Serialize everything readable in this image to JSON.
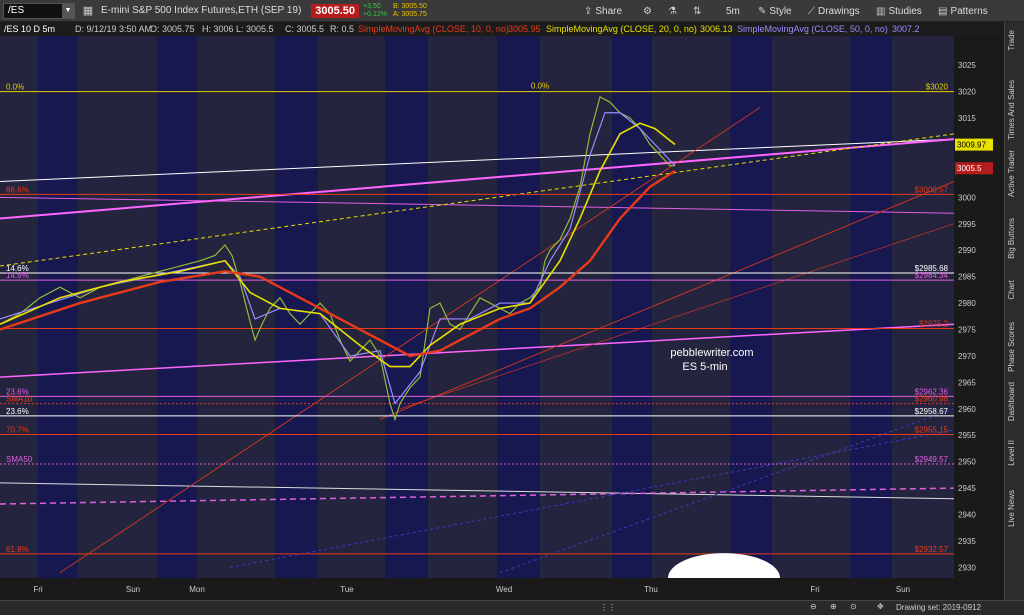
{
  "toolbar": {
    "symbol": "/ES",
    "description": "E-mini S&P 500 Index Futures,ETH (SEP 19)",
    "last": "3005.50",
    "change": "+3.50",
    "change_pct": "+0.12%",
    "bid": "B: 3005.50",
    "ask": "A: 3005.75",
    "share": "Share",
    "timeframe": "5m",
    "style": "Style",
    "drawings": "Drawings",
    "studies": "Studies",
    "patterns": "Patterns"
  },
  "status": {
    "symbol_tf": "/ES 10 D 5m",
    "date": "D: 9/12/19 3:50 AM",
    "open": "O: 3005.75",
    "high": "H: 3006",
    "low": "L: 3005.5",
    "close": "C: 3005.5",
    "range": "R: 0.5",
    "sma10_label": "SimpleMovingAvg (CLOSE, 10, 0, no)",
    "sma10_val": "3005.95",
    "sma20_label": "SimpleMovingAvg (CLOSE, 20, 0, no)",
    "sma20_val": "3006.13",
    "sma50_label": "SimpleMovingAvg (CLOSE, 50, 0, no)",
    "sma50_val": "3007.2"
  },
  "right_tabs": [
    "Trade",
    "Times And Sales",
    "Active Trader",
    "Big Buttons",
    "Chart",
    "Phase Scores",
    "Dashboard",
    "Level II",
    "Live News"
  ],
  "x_labels": [
    "Fri",
    "Sun",
    "Mon",
    "Tue",
    "Wed",
    "Thu",
    "Fri",
    "Sun"
  ],
  "bottom": {
    "drawing_set": "Drawing set: 2019-0912"
  },
  "annotation": {
    "line1": "pebblewriter.com",
    "line2": "ES 5-min"
  },
  "colors": {
    "bg": "#14142a",
    "session": "#1c1c4e",
    "sma10": "#9a8cff",
    "sma20": "#e8e000",
    "sma50": "#e83a1a",
    "price_badge": "#b71c1c"
  },
  "chart_data": {
    "type": "line",
    "y_axis_ticks": [
      2930,
      2935,
      2940,
      2945,
      2950,
      2955,
      2960,
      2965,
      2970,
      2975,
      2980,
      2985,
      2990,
      2995,
      3000,
      3005,
      3010,
      3015,
      3020,
      3025
    ],
    "ylim": [
      2928,
      3029
    ],
    "current_price": 3005.5,
    "levels": [
      {
        "label_left": "0.0%",
        "label_mid": "0.0%",
        "label_right": "$3020",
        "value": 3020,
        "color": "#e8d000",
        "style": "solid"
      },
      {
        "label_left": "88.6%",
        "label_right": "$3000.57",
        "value": 3000.57,
        "color": "#e83a1a",
        "style": "solid"
      },
      {
        "label_left": "14.6%",
        "label_right": "$2985.68",
        "value": 2985.68,
        "color": "#ffffff",
        "style": "solid"
      },
      {
        "label_left": "14.6%",
        "label_right": "$2984.34",
        "value": 2984.34,
        "color": "#e060e0",
        "style": "solid"
      },
      {
        "label_left": "",
        "label_right": "$2975.2",
        "value": 2975.2,
        "color": "#e83a1a",
        "style": "solid"
      },
      {
        "label_left": "23.6%",
        "label_right": "$2962.36",
        "value": 2962.36,
        "color": "#e060e0",
        "style": "solid"
      },
      {
        "label_left": "SMA10",
        "label_right": "$2960.98",
        "value": 2960.98,
        "color": "#e83a1a",
        "style": "dotted"
      },
      {
        "label_left": "23.6%",
        "label_right": "$2958.67",
        "value": 2958.67,
        "color": "#ffffff",
        "style": "solid"
      },
      {
        "label_left": "70.7%",
        "label_right": "$2955.15",
        "value": 2955.15,
        "color": "#e83a1a",
        "style": "solid"
      },
      {
        "label_left": "SMA50",
        "label_right": "$2949.57",
        "value": 2949.57,
        "color": "#e060e0",
        "style": "dotted"
      },
      {
        "label_left": "61.8%",
        "label_right": "$2932.57",
        "value": 2932.57,
        "color": "#e83a1a",
        "style": "solid"
      }
    ],
    "price_tags": [
      {
        "label": "3009.97",
        "value": 3009.97,
        "color": "#e8e000",
        "text": "#000"
      },
      {
        "label": "3005.5",
        "value": 3005.5,
        "color": "#b71c1c",
        "text": "#fff"
      }
    ],
    "price_path": [
      [
        0,
        2976
      ],
      [
        20,
        2978
      ],
      [
        40,
        2981
      ],
      [
        60,
        2983
      ],
      [
        80,
        2981
      ],
      [
        100,
        2983
      ],
      [
        120,
        2984
      ],
      [
        140,
        2985
      ],
      [
        160,
        2986
      ],
      [
        180,
        2987
      ],
      [
        200,
        2988
      ],
      [
        215,
        2989
      ],
      [
        225,
        2991
      ],
      [
        232,
        2989
      ],
      [
        240,
        2984
      ],
      [
        248,
        2978
      ],
      [
        255,
        2973
      ],
      [
        262,
        2976
      ],
      [
        270,
        2979
      ],
      [
        280,
        2981
      ],
      [
        290,
        2978
      ],
      [
        300,
        2976
      ],
      [
        310,
        2978
      ],
      [
        320,
        2980
      ],
      [
        330,
        2978
      ],
      [
        340,
        2973
      ],
      [
        350,
        2969
      ],
      [
        360,
        2971
      ],
      [
        370,
        2973
      ],
      [
        380,
        2970
      ],
      [
        390,
        2961
      ],
      [
        395,
        2958
      ],
      [
        400,
        2961
      ],
      [
        410,
        2964
      ],
      [
        420,
        2966
      ],
      [
        430,
        2979
      ],
      [
        440,
        2980
      ],
      [
        450,
        2976
      ],
      [
        460,
        2975
      ],
      [
        470,
        2978
      ],
      [
        480,
        2981
      ],
      [
        490,
        2980
      ],
      [
        500,
        2979
      ],
      [
        510,
        2978
      ],
      [
        520,
        2980
      ],
      [
        530,
        2981
      ],
      [
        540,
        2983
      ],
      [
        545,
        2988
      ],
      [
        550,
        2990
      ],
      [
        560,
        2992
      ],
      [
        570,
        2996
      ],
      [
        580,
        3002
      ],
      [
        590,
        3012
      ],
      [
        600,
        3019
      ],
      [
        610,
        3018
      ],
      [
        620,
        3016
      ],
      [
        630,
        3015
      ],
      [
        640,
        3013
      ],
      [
        650,
        3010
      ],
      [
        660,
        3008
      ],
      [
        670,
        3006
      ],
      [
        675,
        3006
      ]
    ],
    "sma10_path": [
      [
        0,
        2977
      ],
      [
        50,
        2980
      ],
      [
        100,
        2983
      ],
      [
        150,
        2985
      ],
      [
        200,
        2987
      ],
      [
        225,
        2988
      ],
      [
        240,
        2985
      ],
      [
        255,
        2977
      ],
      [
        280,
        2979
      ],
      [
        320,
        2978
      ],
      [
        350,
        2970
      ],
      [
        380,
        2971
      ],
      [
        395,
        2961
      ],
      [
        420,
        2967
      ],
      [
        440,
        2977
      ],
      [
        470,
        2977
      ],
      [
        500,
        2980
      ],
      [
        530,
        2980
      ],
      [
        550,
        2988
      ],
      [
        570,
        2994
      ],
      [
        590,
        3008
      ],
      [
        605,
        3016
      ],
      [
        620,
        3016
      ],
      [
        640,
        3013
      ],
      [
        660,
        3009
      ],
      [
        675,
        3006
      ]
    ],
    "sma20_path": [
      [
        0,
        2976
      ],
      [
        60,
        2981
      ],
      [
        120,
        2984
      ],
      [
        180,
        2986
      ],
      [
        225,
        2988
      ],
      [
        250,
        2982
      ],
      [
        280,
        2979
      ],
      [
        320,
        2978
      ],
      [
        360,
        2972
      ],
      [
        390,
        2968
      ],
      [
        410,
        2968
      ],
      [
        430,
        2972
      ],
      [
        460,
        2976
      ],
      [
        500,
        2979
      ],
      [
        530,
        2980
      ],
      [
        560,
        2988
      ],
      [
        580,
        2996
      ],
      [
        600,
        3005
      ],
      [
        620,
        3012
      ],
      [
        640,
        3014
      ],
      [
        655,
        3013
      ],
      [
        675,
        3010
      ]
    ],
    "sma50_path": [
      [
        0,
        2975
      ],
      [
        80,
        2980
      ],
      [
        160,
        2984
      ],
      [
        225,
        2986
      ],
      [
        260,
        2985
      ],
      [
        300,
        2981
      ],
      [
        340,
        2977
      ],
      [
        380,
        2973
      ],
      [
        410,
        2970
      ],
      [
        440,
        2971
      ],
      [
        470,
        2974
      ],
      [
        500,
        2977
      ],
      [
        530,
        2979
      ],
      [
        560,
        2983
      ],
      [
        590,
        2988
      ],
      [
        620,
        2996
      ],
      [
        650,
        3002
      ],
      [
        675,
        3005
      ]
    ]
  }
}
